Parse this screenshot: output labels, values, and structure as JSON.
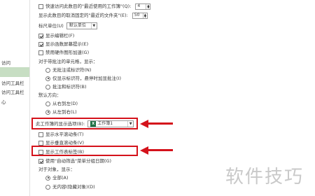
{
  "sidebar": {
    "items": [
      {
        "label": "访问"
      },
      {
        "label": ""
      },
      {
        "label": "访问工具栏"
      },
      {
        "label": "访问工具栏"
      },
      {
        "label": "心"
      }
    ]
  },
  "options": {
    "recent_workbooks": {
      "label": "快速访问此数目的\"最近使用的工作簿\"(Q):",
      "value": "4"
    },
    "recent_unpinned_folders": {
      "label": "显示此数目的取消固定的\"最近的文件夹\"(E):",
      "value": "50"
    },
    "ruler_units": {
      "label": "标尺单位(U)",
      "value": "默认单位"
    },
    "show_formula_bar": {
      "label": "显示编辑栏(F)"
    },
    "show_function_tooltips": {
      "label": "显示函数屏幕提示(E)"
    },
    "disable_hw_acceleration": {
      "label": "禁用硬件图形加速(G)"
    },
    "comments_header": {
      "label": "对于带批注的单元格，显示："
    },
    "no_comments": {
      "label": "无批注或标识符(N)"
    },
    "indicators_only": {
      "label": "仅显示标识符，悬停时加显批注(I)"
    },
    "comments_and_indicators": {
      "label": "批注和标识符(B)"
    },
    "default_direction": {
      "label": "默认方向："
    },
    "right_to_left": {
      "label": "从右到左(D)"
    },
    "left_to_right": {
      "label": "从左到右(L)"
    }
  },
  "workbook_section": {
    "label": "此工作簿的显示选项(B):",
    "selected_workbook": "工作簿1",
    "excel_icon_text": "X",
    "show_horizontal_scrollbar": {
      "label": "显示水平滚动条(T)"
    },
    "show_vertical_scrollbar": {
      "label": "显示垂直滚动条(V)"
    },
    "show_sheet_tabs": {
      "label": "显示工作表标签(B)"
    },
    "group_dates_autofilter": {
      "label": "使用\"自动筛选\"菜单分组日期(G)"
    },
    "objects_header": {
      "label": "对于对象，显示："
    },
    "objects_all": {
      "label": "全部(A)"
    },
    "objects_nothing": {
      "label": "无内容(隐藏对象)(D)"
    }
  },
  "colors": {
    "highlight": "#d4121b",
    "active_nav": "#c7dec3"
  },
  "watermark": "软件技巧"
}
